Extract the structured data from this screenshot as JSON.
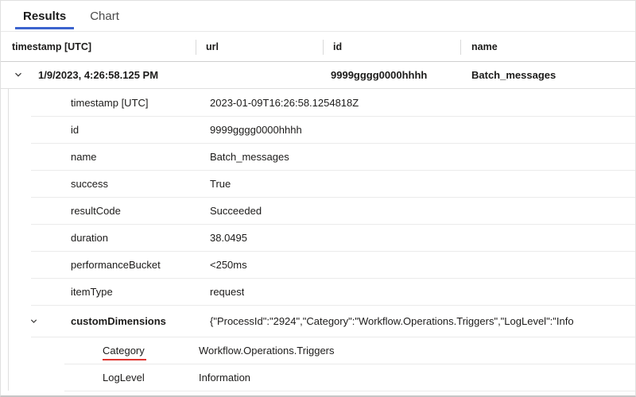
{
  "tabs": {
    "results": "Results",
    "chart": "Chart"
  },
  "table": {
    "columns": [
      "timestamp [UTC]",
      "url",
      "id",
      "name"
    ],
    "row": {
      "timestamp": "1/9/2023, 4:26:58.125 PM",
      "url": "",
      "id": "9999gggg0000hhhh",
      "name": "Batch_messages"
    },
    "details": [
      {
        "label": "timestamp [UTC]",
        "value": "2023-01-09T16:26:58.1254818Z"
      },
      {
        "label": "id",
        "value": "9999gggg0000hhhh"
      },
      {
        "label": "name",
        "value": "Batch_messages"
      },
      {
        "label": "success",
        "value": "True"
      },
      {
        "label": "resultCode",
        "value": "Succeeded"
      },
      {
        "label": "duration",
        "value": "38.0495"
      },
      {
        "label": "performanceBucket",
        "value": "<250ms"
      },
      {
        "label": "itemType",
        "value": "request"
      }
    ],
    "custom_dimensions": {
      "label": "customDimensions",
      "value": "{\"ProcessId\":\"2924\",\"Category\":\"Workflow.Operations.Triggers\",\"LogLevel\":\"Info",
      "children": [
        {
          "label": "Category",
          "value": "Workflow.Operations.Triggers"
        },
        {
          "label": "LogLevel",
          "value": "Information"
        }
      ]
    }
  },
  "colors": {
    "accent_blue": "#3b63ce",
    "annotation_red": "#df342f",
    "header_border": "#cfcfcf",
    "row_separator": "#ebebeb"
  }
}
